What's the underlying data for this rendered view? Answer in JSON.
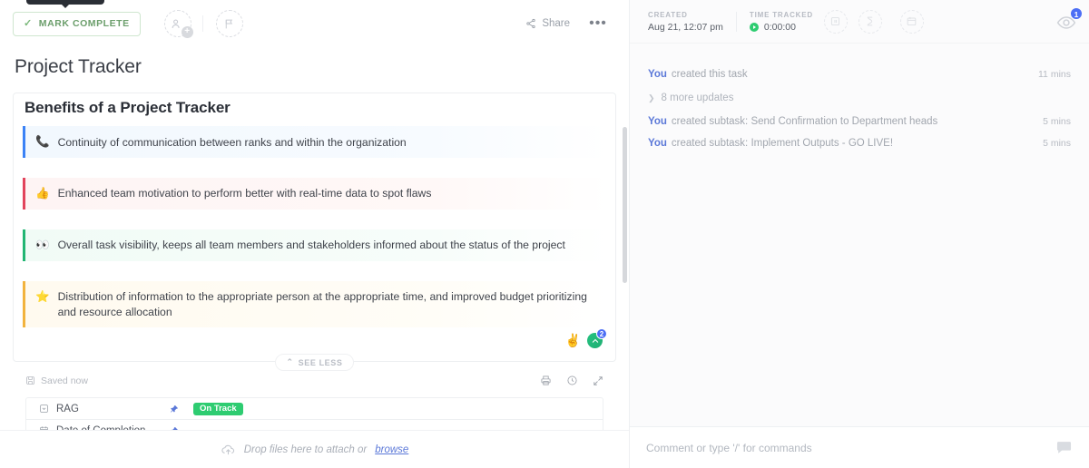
{
  "task": {
    "mark_complete_label": "MARK COMPLETE",
    "title": "Project Tracker",
    "share_label": "Share",
    "more_label": "•••",
    "assignee_icon": "assignee-add-icon",
    "priority_icon": "flag-icon"
  },
  "description": {
    "heading": "Benefits of a Project Tracker",
    "callouts": [
      {
        "emoji": "📞",
        "emoji_name": "telephone-emoji",
        "text": "Continuity of communication between ranks and within the organization",
        "accent": "#3b82f6",
        "style": "c-blue"
      },
      {
        "emoji": "👍",
        "emoji_name": "thumbs-up-emoji",
        "text": "Enhanced team motivation to perform better with real-time data to spot flaws",
        "accent": "#e2445c",
        "style": "c-red"
      },
      {
        "emoji": "👀",
        "emoji_name": "eyes-emoji",
        "text": "Overall task visibility, keeps all team members and stakeholders informed about the status of the project",
        "accent": "#22b573",
        "style": "c-green"
      },
      {
        "emoji": "⭐",
        "emoji_name": "star-emoji",
        "text": "Distribution of information to the appropriate person at the appropriate time, and improved budget prioritizing and resource allocation",
        "accent": "#f2b33d",
        "style": "c-yellow"
      }
    ],
    "reactions": [
      {
        "name": "raised-hand-emoji",
        "glyph": "✌️",
        "count": ""
      },
      {
        "name": "clickup-reaction",
        "glyph": "",
        "count": "2"
      }
    ],
    "see_less_label": "SEE LESS",
    "see_less_chevron": "⌃"
  },
  "saved_bar": {
    "status": "Saved now",
    "icons": [
      {
        "name": "print-icon"
      },
      {
        "name": "history-icon"
      },
      {
        "name": "expand-icon"
      }
    ]
  },
  "custom_fields": {
    "rows": [
      {
        "icon": "dropdown-field-icon",
        "label": "RAG",
        "value": "On Track",
        "value_type": "badge",
        "badge_color": "#2ecc71"
      },
      {
        "icon": "date-field-icon",
        "label": "Date of Completion",
        "value": "-",
        "value_type": "text"
      }
    ]
  },
  "drop_files": {
    "text": "Drop files here to attach or",
    "link": "browse",
    "icon": "cloud-upload-icon"
  },
  "right_header": {
    "created_label": "CREATED",
    "created_value": "Aug 21, 12:07 pm",
    "time_tracked_label": "TIME TRACKED",
    "time_tracked_value": "0:00:00",
    "icons": [
      {
        "name": "time-estimate-icon"
      },
      {
        "name": "timer-icon"
      },
      {
        "name": "calendar-icon"
      }
    ],
    "watchers_count": "1",
    "watchers_icon": "eye-icon"
  },
  "activity": {
    "more_updates_label": "8 more updates",
    "items": [
      {
        "who": "You",
        "what": "created this task",
        "time": "11 mins"
      },
      {
        "who": "You",
        "what": "created subtask: Send Confirmation to Department heads",
        "time": "5 mins"
      },
      {
        "who": "You",
        "what": "created subtask: Implement Outputs - GO LIVE!",
        "time": "5 mins"
      }
    ]
  },
  "comment_bar": {
    "placeholder": "Comment or type '/' for commands",
    "bubble_icon": "chat-bubble-icon"
  },
  "colors": {
    "accent_blue": "#5b78d8",
    "green": "#2ecc71",
    "badge_blue": "#4c6ef5"
  }
}
